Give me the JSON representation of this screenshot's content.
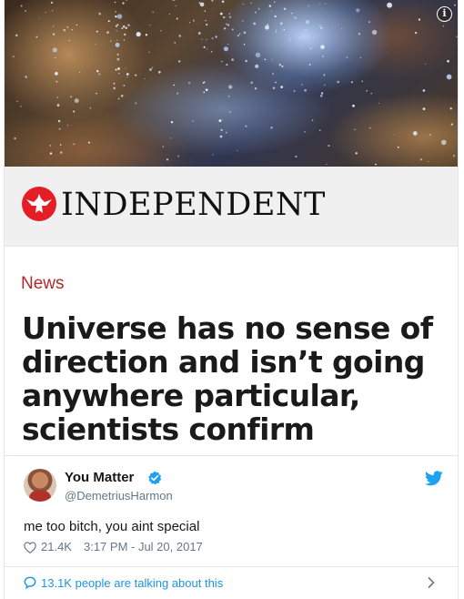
{
  "card": {
    "brand": "INDEPENDENT",
    "section": "News",
    "headline": "Universe has no sense of direction and isn’t going anywhere particular, scientists confirm",
    "info_icon": "i"
  },
  "tweet": {
    "display_name": "You Matter",
    "handle": "@DemetriusHarmon",
    "text": "me too bitch, you aint special",
    "likes": "21.4K",
    "timestamp": "3:17 PM - Jul 20, 2017",
    "talking": "13.1K people are talking about this"
  },
  "colors": {
    "twitter_blue": "#1b95e0",
    "verified_blue": "#1da1f2",
    "brand_red": "#e41e26",
    "section_red": "#b02a2a",
    "meta_gray": "#657786"
  },
  "icons": [
    "info-icon",
    "independent-eagle-logo",
    "verified-badge-icon",
    "twitter-bird-icon",
    "heart-icon",
    "speech-bubble-icon",
    "chevron-right-icon"
  ]
}
